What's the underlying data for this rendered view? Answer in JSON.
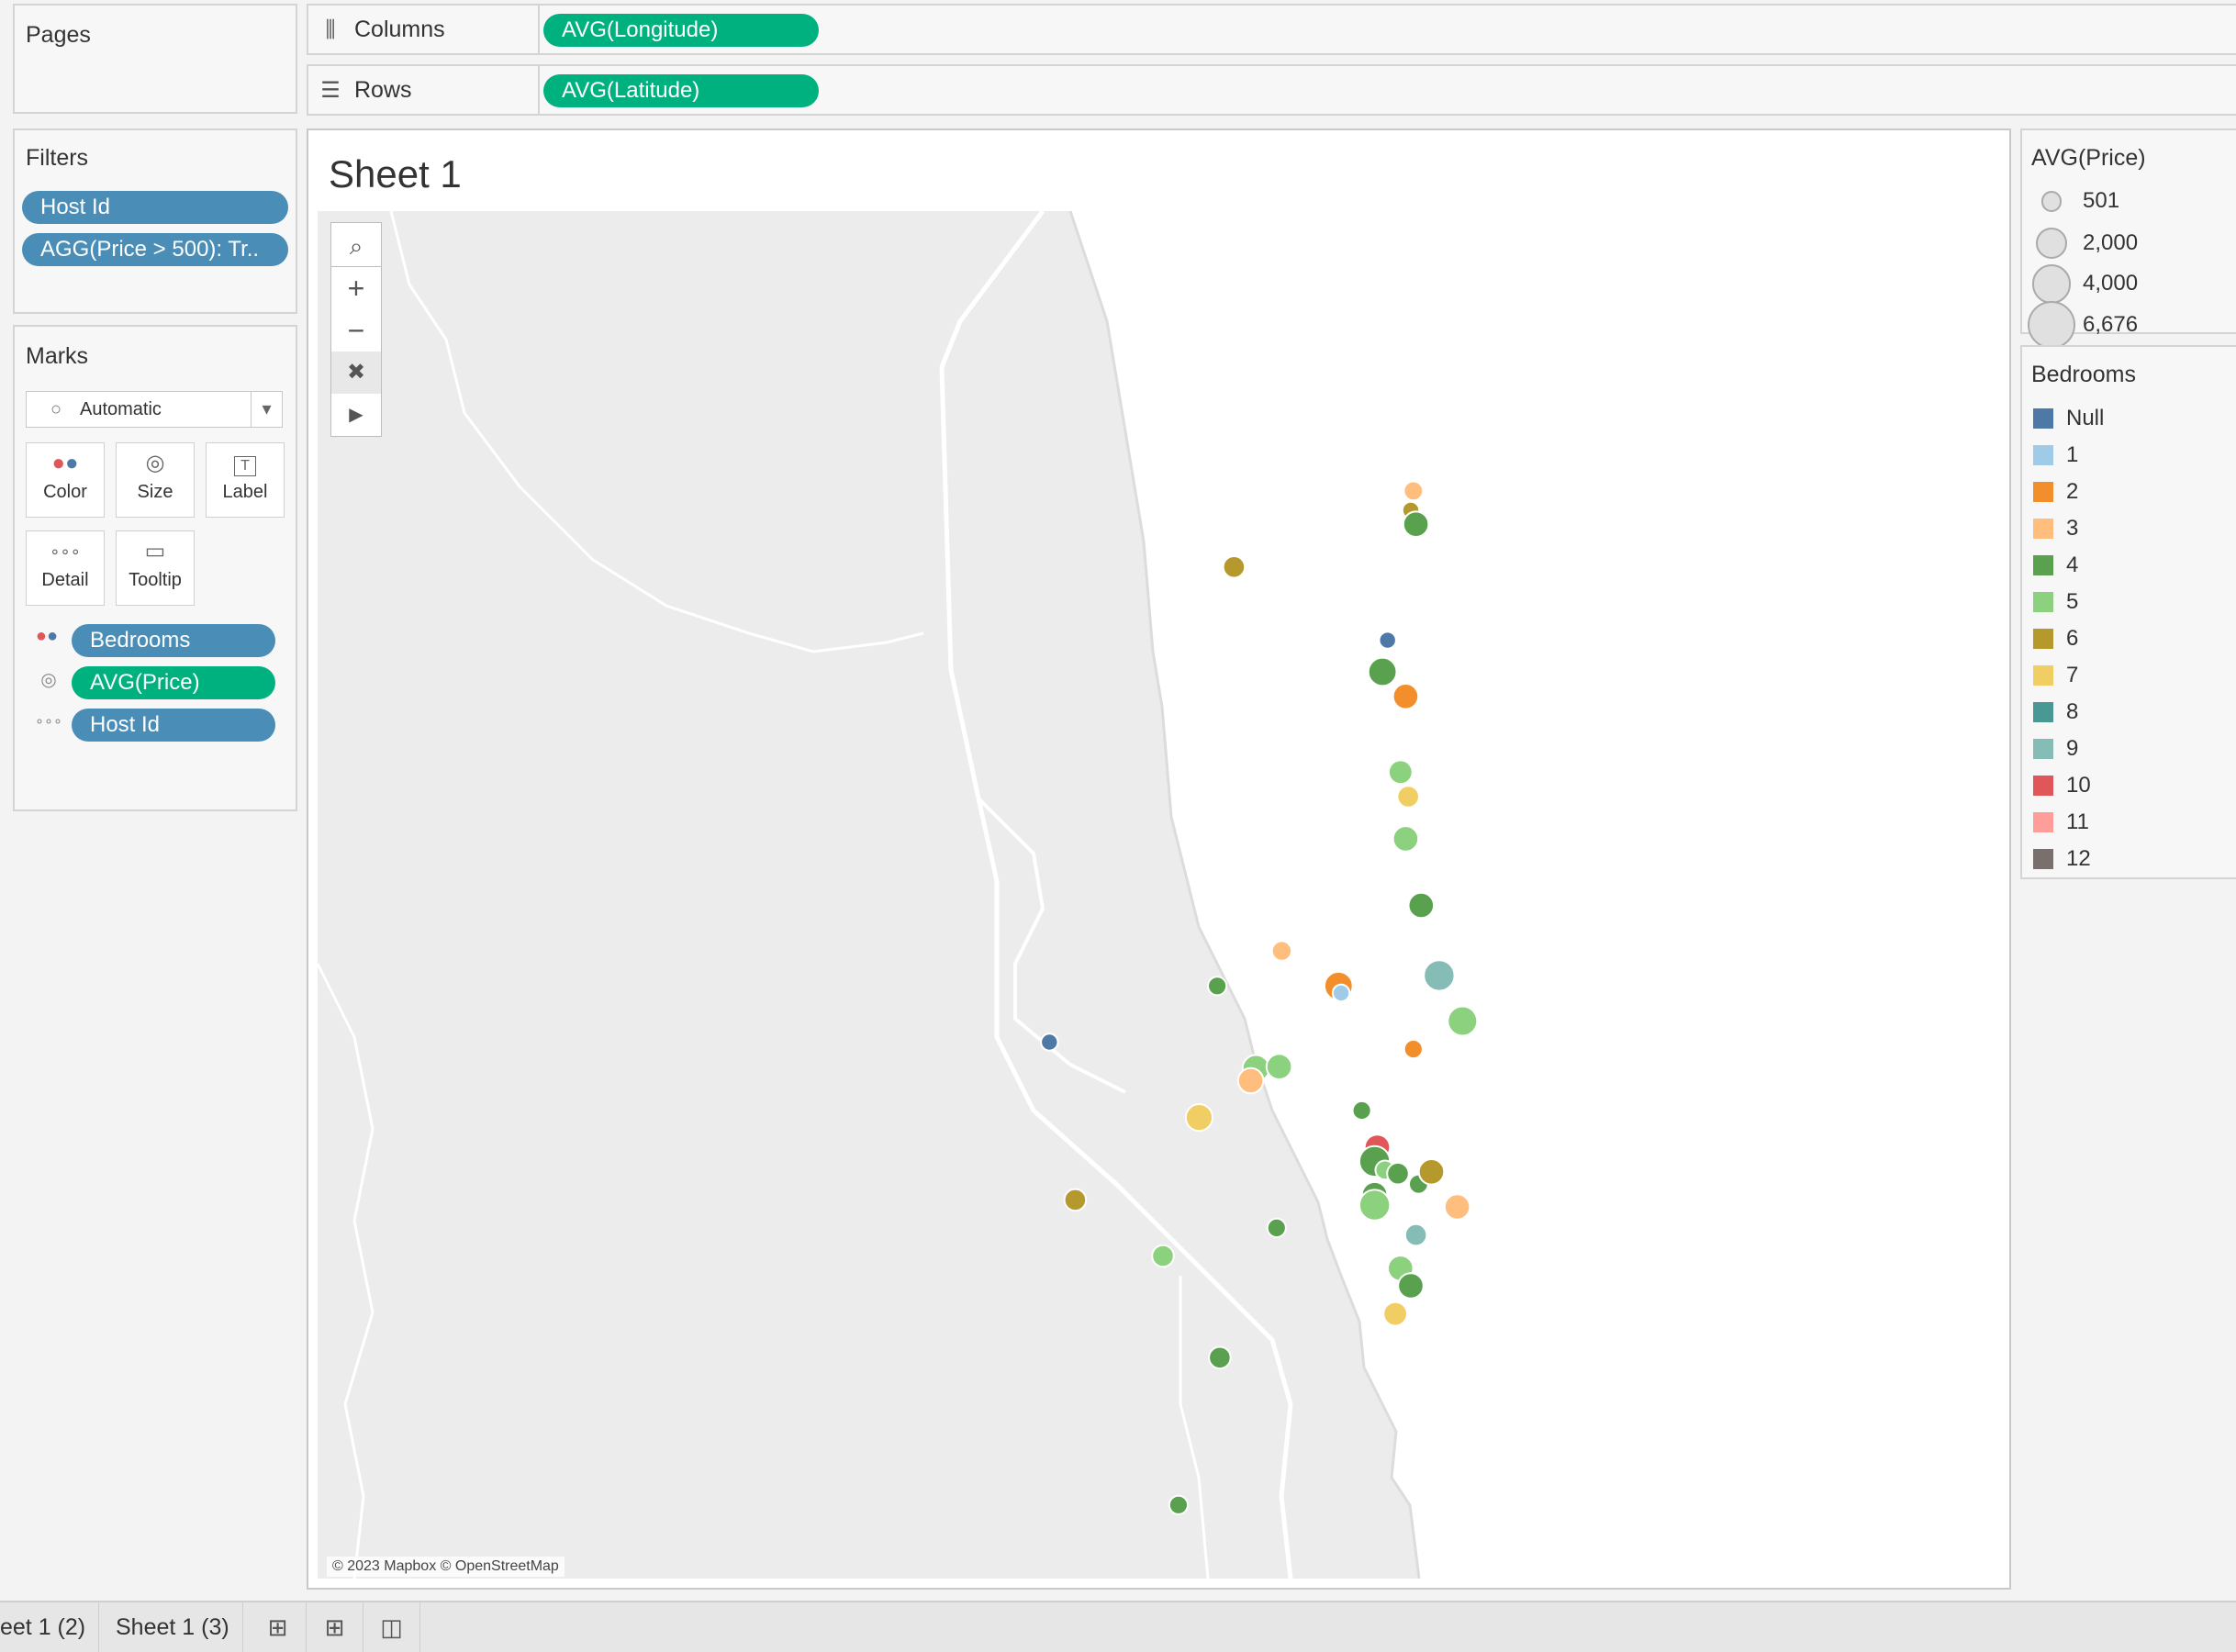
{
  "pages_panel": {
    "title": "Pages"
  },
  "shelves": {
    "columns": {
      "label": "Columns",
      "pill": "AVG(Longitude)"
    },
    "rows": {
      "label": "Rows",
      "pill": "AVG(Latitude)"
    }
  },
  "filters_panel": {
    "title": "Filters",
    "items": [
      "Host Id",
      "AGG(Price > 500): Tr.."
    ]
  },
  "marks_panel": {
    "title": "Marks",
    "mark_type": "Automatic",
    "buttons": {
      "color": "Color",
      "size": "Size",
      "label": "Label",
      "detail": "Detail",
      "tooltip": "Tooltip"
    },
    "pills": [
      {
        "text": "Bedrooms",
        "encoding": "color",
        "icon": "color-icon",
        "color": "#4a8db7"
      },
      {
        "text": "AVG(Price)",
        "encoding": "size",
        "icon": "size-icon",
        "color": "#00b180"
      },
      {
        "text": "Host Id",
        "encoding": "detail",
        "icon": "detail-icon",
        "color": "#4a8db7"
      }
    ]
  },
  "view": {
    "title": "Sheet 1",
    "attribution": "© 2023 Mapbox © OpenStreetMap",
    "tools": [
      "search-icon",
      "zoom-in-icon",
      "zoom-out-icon",
      "pin-map-icon",
      "expand-arrow-icon"
    ]
  },
  "size_legend": {
    "title": "AVG(Price)",
    "items": [
      {
        "label": "501",
        "value": 501
      },
      {
        "label": "2,000",
        "value": 2000
      },
      {
        "label": "4,000",
        "value": 4000
      },
      {
        "label": "6,676",
        "value": 6676
      }
    ]
  },
  "color_legend": {
    "title": "Bedrooms",
    "items": [
      {
        "label": "Null",
        "color": "#4e79a7"
      },
      {
        "label": "1",
        "color": "#a0cbe8"
      },
      {
        "label": "2",
        "color": "#f28e2b"
      },
      {
        "label": "3",
        "color": "#ffbe7d"
      },
      {
        "label": "4",
        "color": "#59a14f"
      },
      {
        "label": "5",
        "color": "#8cd17d"
      },
      {
        "label": "6",
        "color": "#b6992d"
      },
      {
        "label": "7",
        "color": "#f1ce63"
      },
      {
        "label": "8",
        "color": "#499894"
      },
      {
        "label": "9",
        "color": "#86bcb6"
      },
      {
        "label": "10",
        "color": "#e15759"
      },
      {
        "label": "11",
        "color": "#ff9d9a"
      },
      {
        "label": "12",
        "color": "#79706e"
      }
    ]
  },
  "tabs": [
    "eet 1 (2)",
    "Sheet 1 (3)"
  ],
  "tab_icons": [
    "new-worksheet-icon",
    "new-dashboard-icon",
    "new-story-icon"
  ],
  "chart_data": {
    "type": "scatter",
    "description_fields": {
      "x": "AVG(Longitude)",
      "y": "AVG(Latitude)",
      "color": "Bedrooms",
      "size": "AVG(Price)"
    },
    "points": [
      {
        "x": -87.6255,
        "y": 41.9902,
        "bedrooms": "3",
        "price": 550
      },
      {
        "x": -87.6265,
        "y": 41.9847,
        "bedrooms": "6",
        "price": 520
      },
      {
        "x": -87.6245,
        "y": 41.9807,
        "bedrooms": "4",
        "price": 700
      },
      {
        "x": -87.695,
        "y": 41.9685,
        "bedrooms": "6",
        "price": 600
      },
      {
        "x": -87.6355,
        "y": 41.9476,
        "bedrooms": "Null",
        "price": 520
      },
      {
        "x": -87.6375,
        "y": 41.9386,
        "bedrooms": "4",
        "price": 800
      },
      {
        "x": -87.6285,
        "y": 41.9316,
        "bedrooms": "2",
        "price": 700
      },
      {
        "x": -87.6305,
        "y": 41.91,
        "bedrooms": "5",
        "price": 650
      },
      {
        "x": -87.6275,
        "y": 41.903,
        "bedrooms": "7",
        "price": 600
      },
      {
        "x": -87.6285,
        "y": 41.891,
        "bedrooms": "5",
        "price": 700
      },
      {
        "x": -87.6225,
        "y": 41.872,
        "bedrooms": "4",
        "price": 700
      },
      {
        "x": -87.6155,
        "y": 41.852,
        "bedrooms": "9",
        "price": 900
      },
      {
        "x": -87.6545,
        "y": 41.849,
        "bedrooms": "2",
        "price": 800
      },
      {
        "x": -87.6535,
        "y": 41.847,
        "bedrooms": "1",
        "price": 520
      },
      {
        "x": -87.6765,
        "y": 41.859,
        "bedrooms": "3",
        "price": 560
      },
      {
        "x": -87.7015,
        "y": 41.849,
        "bedrooms": "4",
        "price": 540
      },
      {
        "x": -87.7665,
        "y": 41.833,
        "bedrooms": "Null",
        "price": 520
      },
      {
        "x": -87.6865,
        "y": 41.8255,
        "bedrooms": "5",
        "price": 750
      },
      {
        "x": -87.6885,
        "y": 41.822,
        "bedrooms": "3",
        "price": 700
      },
      {
        "x": -87.6775,
        "y": 41.826,
        "bedrooms": "5",
        "price": 700
      },
      {
        "x": -87.6065,
        "y": 41.839,
        "bedrooms": "5",
        "price": 850
      },
      {
        "x": -87.6255,
        "y": 41.831,
        "bedrooms": "2",
        "price": 540
      },
      {
        "x": -87.7085,
        "y": 41.8115,
        "bedrooms": "7",
        "price": 750
      },
      {
        "x": -87.6455,
        "y": 41.8135,
        "bedrooms": "4",
        "price": 540
      },
      {
        "x": -87.6395,
        "y": 41.803,
        "bedrooms": "10",
        "price": 700
      },
      {
        "x": -87.6405,
        "y": 41.799,
        "bedrooms": "4",
        "price": 900
      },
      {
        "x": -87.6365,
        "y": 41.7965,
        "bedrooms": "5",
        "price": 550
      },
      {
        "x": -87.6315,
        "y": 41.7955,
        "bedrooms": "4",
        "price": 600
      },
      {
        "x": -87.6235,
        "y": 41.7925,
        "bedrooms": "4",
        "price": 550
      },
      {
        "x": -87.6405,
        "y": 41.7895,
        "bedrooms": "4",
        "price": 700
      },
      {
        "x": -87.6405,
        "y": 41.7865,
        "bedrooms": "5",
        "price": 900
      },
      {
        "x": -87.6085,
        "y": 41.786,
        "bedrooms": "3",
        "price": 700
      },
      {
        "x": -87.6185,
        "y": 41.796,
        "bedrooms": "6",
        "price": 700
      },
      {
        "x": -87.6245,
        "y": 41.778,
        "bedrooms": "9",
        "price": 600
      },
      {
        "x": -87.6305,
        "y": 41.7685,
        "bedrooms": "5",
        "price": 700
      },
      {
        "x": -87.6265,
        "y": 41.7635,
        "bedrooms": "4",
        "price": 700
      },
      {
        "x": -87.6325,
        "y": 41.7555,
        "bedrooms": "7",
        "price": 650
      },
      {
        "x": -87.6785,
        "y": 41.78,
        "bedrooms": "4",
        "price": 540
      },
      {
        "x": -87.7225,
        "y": 41.772,
        "bedrooms": "5",
        "price": 600
      },
      {
        "x": -87.7005,
        "y": 41.743,
        "bedrooms": "4",
        "price": 600
      },
      {
        "x": -87.7165,
        "y": 41.701,
        "bedrooms": "4",
        "price": 540
      },
      {
        "x": -87.7565,
        "y": 41.788,
        "bedrooms": "6",
        "price": 600
      }
    ]
  }
}
